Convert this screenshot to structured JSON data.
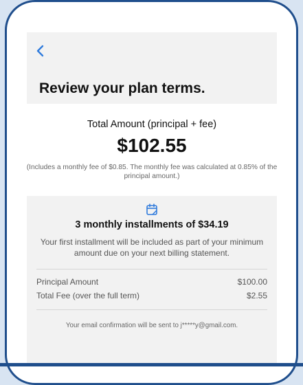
{
  "header": {
    "back_icon": "chevron-left-icon",
    "title": "Review your plan terms."
  },
  "total": {
    "label": "Total Amount (principal + fee)",
    "value": "$102.55",
    "note": "(Includes a monthly fee of $0.85. The monthly fee was calculated at 0.85% of the principal amount.)"
  },
  "installments": {
    "icon": "calendar-icon",
    "title": "3 monthly installments of $34.19",
    "note": "Your first installment will be included as part of your minimum amount due on your next billing statement."
  },
  "breakdown": [
    {
      "label": "Principal Amount",
      "value": "$100.00"
    },
    {
      "label": "Total Fee (over the full term)",
      "value": "$2.55"
    }
  ],
  "email_note": "Your email confirmation will be sent to j*****y@gmail.com.",
  "colors": {
    "accent": "#2f7bdc",
    "frame": "#1f4e8c",
    "screen_bg": "#f2f2f2"
  }
}
